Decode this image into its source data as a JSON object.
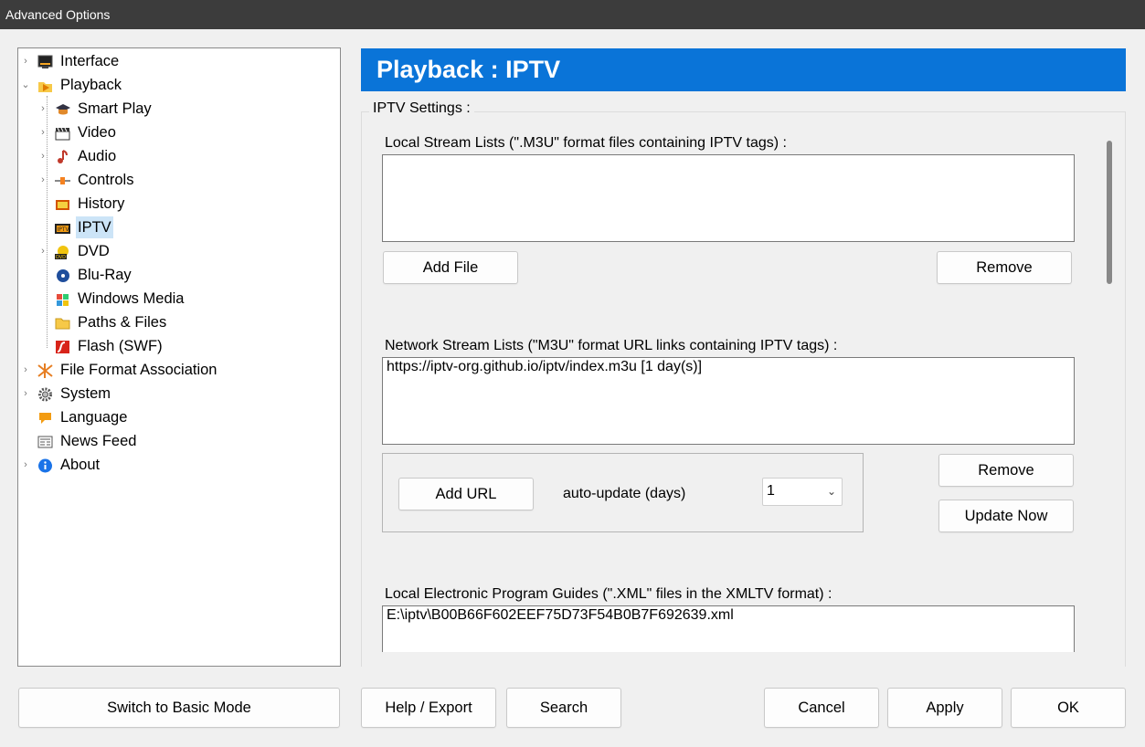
{
  "window": {
    "title": "Advanced Options"
  },
  "tree": {
    "items": [
      {
        "label": "Interface",
        "icon": "monitor-icon"
      },
      {
        "label": "Playback",
        "icon": "play-folder-icon"
      },
      {
        "label": "Smart Play",
        "icon": "graduation-cap-icon"
      },
      {
        "label": "Video",
        "icon": "clapperboard-icon"
      },
      {
        "label": "Audio",
        "icon": "music-note-icon"
      },
      {
        "label": "Controls",
        "icon": "slider-icon"
      },
      {
        "label": "History",
        "icon": "history-icon"
      },
      {
        "label": "IPTV",
        "icon": "tv-icon"
      },
      {
        "label": "DVD",
        "icon": "dvd-icon"
      },
      {
        "label": "Blu-Ray",
        "icon": "bluray-icon"
      },
      {
        "label": "Windows Media",
        "icon": "windows-media-icon"
      },
      {
        "label": "Paths & Files",
        "icon": "folder-icon"
      },
      {
        "label": "Flash (SWF)",
        "icon": "flash-icon"
      },
      {
        "label": "File Format Association",
        "icon": "file-association-icon"
      },
      {
        "label": "System",
        "icon": "gear-icon"
      },
      {
        "label": "Language",
        "icon": "language-icon"
      },
      {
        "label": "News Feed",
        "icon": "newspaper-icon"
      },
      {
        "label": "About",
        "icon": "info-icon"
      }
    ],
    "selected": "IPTV"
  },
  "panel": {
    "title": "Playback : IPTV",
    "group_title": "IPTV Settings :",
    "local_lists": {
      "label": "Local Stream Lists (\".M3U\" format files containing IPTV tags) :",
      "items": [],
      "add_label": "Add File",
      "remove_label": "Remove"
    },
    "network_lists": {
      "label": "Network Stream Lists (\"M3U\" format URL links containing IPTV tags) :",
      "items": [
        "https://iptv-org.github.io/iptv/index.m3u [1 day(s)]"
      ],
      "add_label": "Add URL",
      "auto_update_label": "auto-update (days)",
      "auto_update_value": "1",
      "remove_label": "Remove",
      "update_label": "Update Now"
    },
    "epg": {
      "label": "Local Electronic Program Guides (\".XML\" files in the XMLTV format) :",
      "items": [
        "E:\\iptv\\B00B66F602EEF75D73F54B0B7F692639.xml"
      ]
    }
  },
  "footer": {
    "basic_mode": "Switch to Basic Mode",
    "help": "Help / Export",
    "search": "Search",
    "cancel": "Cancel",
    "apply": "Apply",
    "ok": "OK"
  },
  "colors": {
    "header_bg": "#0a74d8",
    "selection_bg": "#cce4f7"
  }
}
